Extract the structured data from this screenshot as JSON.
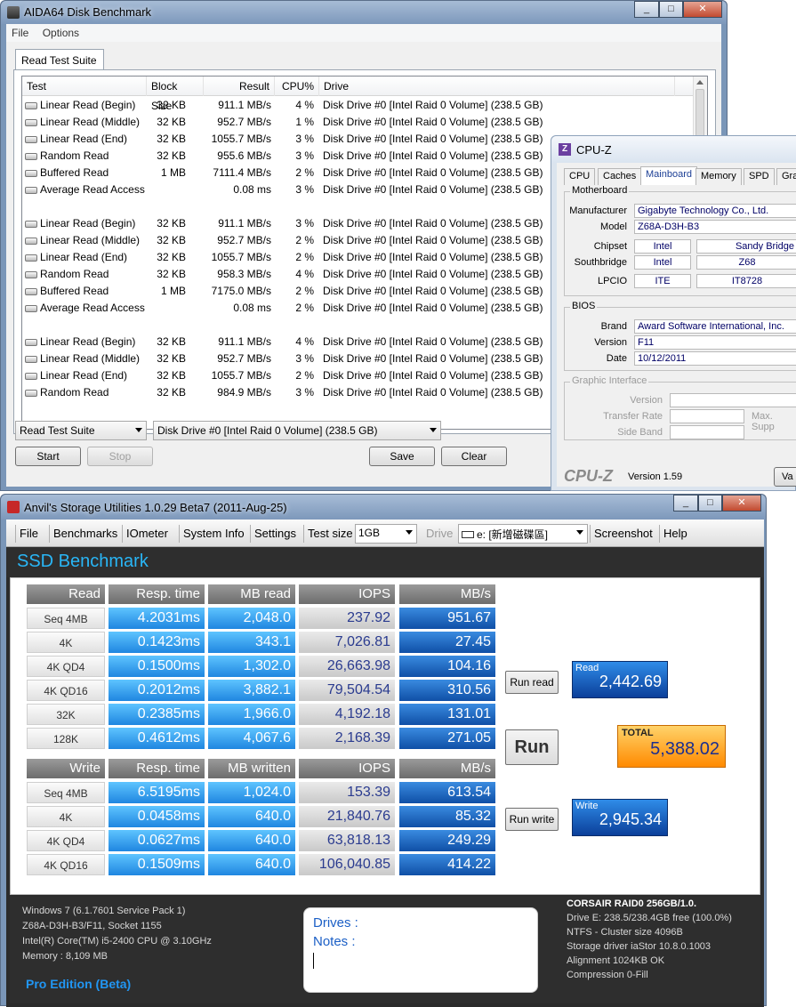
{
  "aida": {
    "title": "AIDA64 Disk Benchmark",
    "menu": [
      "File",
      "Options"
    ],
    "tab": "Read Test Suite",
    "columns": [
      "Test",
      "Block Size",
      "Result",
      "CPU%",
      "Drive"
    ],
    "rows": [
      [
        "Linear Read (Begin)",
        "32 KB",
        "911.1 MB/s",
        "4 %",
        "Disk Drive #0  [Intel   Raid 0 Volume]  (238.5 GB)"
      ],
      [
        "Linear Read (Middle)",
        "32 KB",
        "952.7 MB/s",
        "1 %",
        "Disk Drive #0  [Intel   Raid 0 Volume]  (238.5 GB)"
      ],
      [
        "Linear Read (End)",
        "32 KB",
        "1055.7 MB/s",
        "3 %",
        "Disk Drive #0  [Intel   Raid 0 Volume]  (238.5 GB)"
      ],
      [
        "Random Read",
        "32 KB",
        "955.6 MB/s",
        "3 %",
        "Disk Drive #0  [Intel   Raid 0 Volume]  (238.5 GB)"
      ],
      [
        "Buffered Read",
        "1 MB",
        "7111.4 MB/s",
        "2 %",
        "Disk Drive #0  [Intel   Raid 0 Volume]  (238.5 GB)"
      ],
      [
        "Average Read Access",
        "",
        "0.08 ms",
        "3 %",
        "Disk Drive #0  [Intel   Raid 0 Volume]  (238.5 GB)"
      ],
      [
        "",
        "",
        "",
        "",
        ""
      ],
      [
        "Linear Read (Begin)",
        "32 KB",
        "911.1 MB/s",
        "3 %",
        "Disk Drive #0  [Intel   Raid 0 Volume]  (238.5 GB)"
      ],
      [
        "Linear Read (Middle)",
        "32 KB",
        "952.7 MB/s",
        "2 %",
        "Disk Drive #0  [Intel   Raid 0 Volume]  (238.5 GB)"
      ],
      [
        "Linear Read (End)",
        "32 KB",
        "1055.7 MB/s",
        "2 %",
        "Disk Drive #0  [Intel   Raid 0 Volume]  (238.5 GB)"
      ],
      [
        "Random Read",
        "32 KB",
        "958.3 MB/s",
        "4 %",
        "Disk Drive #0  [Intel   Raid 0 Volume]  (238.5 GB)"
      ],
      [
        "Buffered Read",
        "1 MB",
        "7175.0 MB/s",
        "2 %",
        "Disk Drive #0  [Intel   Raid 0 Volume]  (238.5 GB)"
      ],
      [
        "Average Read Access",
        "",
        "0.08 ms",
        "2 %",
        "Disk Drive #0  [Intel   Raid 0 Volume]  (238.5 GB)"
      ],
      [
        "",
        "",
        "",
        "",
        ""
      ],
      [
        "Linear Read (Begin)",
        "32 KB",
        "911.1 MB/s",
        "4 %",
        "Disk Drive #0  [Intel   Raid 0 Volume]  (238.5 GB)"
      ],
      [
        "Linear Read (Middle)",
        "32 KB",
        "952.7 MB/s",
        "3 %",
        "Disk Drive #0  [Intel   Raid 0 Volume]  (238.5 GB)"
      ],
      [
        "Linear Read (End)",
        "32 KB",
        "1055.7 MB/s",
        "2 %",
        "Disk Drive #0  [Intel   Raid 0 Volume]  (238.5 GB)"
      ],
      [
        "Random Read",
        "32 KB",
        "984.9 MB/s",
        "3 %",
        "Disk Drive #0  [Intel   Raid 0 Volume]  (238.5 GB)"
      ]
    ],
    "suite_select": "Read Test Suite",
    "drive_select": "Disk Drive #0  [Intel   Raid 0 Volume]  (238.5 GB)",
    "buttons": {
      "start": "Start",
      "stop": "Stop",
      "save": "Save",
      "clear": "Clear"
    }
  },
  "cpuz": {
    "title": "CPU-Z",
    "logo_letter": "Z",
    "tabs": [
      "CPU",
      "Caches",
      "Mainboard",
      "Memory",
      "SPD",
      "Gra"
    ],
    "motherboard_title": "Motherboard",
    "manufacturer_label": "Manufacturer",
    "manufacturer": "Gigabyte Technology Co., Ltd.",
    "model_label": "Model",
    "model": "Z68A-D3H-B3",
    "chipset_label": "Chipset",
    "chipset_vendor": "Intel",
    "chipset_name": "Sandy Bridge",
    "southbridge_label": "Southbridge",
    "southbridge_vendor": "Intel",
    "southbridge_name": "Z68",
    "lpcio_label": "LPCIO",
    "lpcio_vendor": "ITE",
    "lpcio_name": "IT8728",
    "bios_title": "BIOS",
    "brand_label": "Brand",
    "brand": "Award Software International, Inc.",
    "version_label": "Version",
    "version": "F11",
    "date_label": "Date",
    "date": "10/12/2011",
    "gi_title": "Graphic Interface",
    "gi_version_label": "Version",
    "gi_transfer_label": "Transfer Rate",
    "gi_max_label": "Max. Supp",
    "gi_side_label": "Side Band",
    "brand_logo": "CPU-Z",
    "app_version": "Version 1.59",
    "button_partial": "Va"
  },
  "anvil": {
    "title": "Anvil's Storage Utilities 1.0.29 Beta7 (2011-Aug-25)",
    "toolbar": {
      "file": "File",
      "benchmarks": "Benchmarks",
      "iometer": "IOmeter",
      "sysinfo": "System Info",
      "settings": "Settings",
      "testsize_label": "Test size",
      "testsize": "1GB",
      "drive_label": "Drive",
      "drive": "e: [新增磁碟區]",
      "screenshot": "Screenshot",
      "help": "Help"
    },
    "banner": "SSD Benchmark",
    "read_headers": [
      "Read",
      "Resp. time",
      "MB read",
      "IOPS",
      "MB/s"
    ],
    "read_rows": [
      [
        "Seq 4MB",
        "4.2031ms",
        "2,048.0",
        "237.92",
        "951.67"
      ],
      [
        "4K",
        "0.1423ms",
        "343.1",
        "7,026.81",
        "27.45"
      ],
      [
        "4K QD4",
        "0.1500ms",
        "1,302.0",
        "26,663.98",
        "104.16"
      ],
      [
        "4K QD16",
        "0.2012ms",
        "3,882.1",
        "79,504.54",
        "310.56"
      ],
      [
        "32K",
        "0.2385ms",
        "1,966.0",
        "4,192.18",
        "131.01"
      ],
      [
        "128K",
        "0.4612ms",
        "4,067.6",
        "2,168.39",
        "271.05"
      ]
    ],
    "write_headers": [
      "Write",
      "Resp. time",
      "MB written",
      "IOPS",
      "MB/s"
    ],
    "write_rows": [
      [
        "Seq 4MB",
        "6.5195ms",
        "1,024.0",
        "153.39",
        "613.54"
      ],
      [
        "4K",
        "0.0458ms",
        "640.0",
        "21,840.76",
        "85.32"
      ],
      [
        "4K QD4",
        "0.0627ms",
        "640.0",
        "63,818.13",
        "249.29"
      ],
      [
        "4K QD16",
        "0.1509ms",
        "640.0",
        "106,040.85",
        "414.22"
      ]
    ],
    "run_read": "Run read",
    "run": "Run",
    "run_write": "Run write",
    "read_label": "Read",
    "read_score": "2,442.69",
    "total_label": "TOTAL",
    "total_score": "5,388.02",
    "write_label": "Write",
    "write_score": "2,945.34",
    "sysinfo": [
      "Windows 7 (6.1.7601 Service Pack 1)",
      "Z68A-D3H-B3/F11, Socket 1155",
      "Intel(R) Core(TM) i5-2400 CPU @ 3.10GHz",
      "Memory : 8,109 MB"
    ],
    "edition": "Pro Edition (Beta)",
    "drives_label": "Drives :",
    "notes_label": "Notes :",
    "drive_info_title": "CORSAIR RAID0 256GB/1.0.",
    "drive_info": [
      "Drive E: 238.5/238.4GB free (100.0%)",
      "NTFS - Cluster size 4096B",
      "Storage driver  iaStor 10.8.0.1003",
      "Alignment 1024KB OK",
      "Compression 0-Fill"
    ]
  }
}
